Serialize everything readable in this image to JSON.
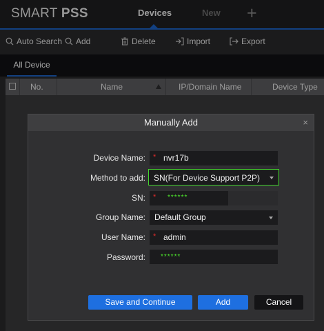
{
  "app": {
    "logo_prefix": "SMART ",
    "logo_bold": "PSS",
    "tabs": [
      {
        "label": "Devices",
        "active": true
      },
      {
        "label": "New",
        "active": false
      }
    ],
    "plus_label": "+"
  },
  "toolbar": {
    "auto_search": "Auto Search",
    "add": "Add",
    "delete": "Delete",
    "import": "Import",
    "export": "Export"
  },
  "list": {
    "tab": "All Device",
    "columns": [
      "No.",
      "Name",
      "IP/Domain Name",
      "Device Type"
    ]
  },
  "dialog": {
    "title": "Manually Add",
    "close_icon": "×",
    "fields": {
      "device_name": {
        "label": "Device Name:",
        "value": "nvr17b",
        "required": true
      },
      "method": {
        "label": "Method to add:",
        "value": "SN(For Device Support P2P)"
      },
      "sn": {
        "label": "SN:",
        "value": "******",
        "required": true
      },
      "group": {
        "label": "Group Name:",
        "value": "Default Group"
      },
      "user": {
        "label": "User Name:",
        "value": "admin",
        "required": true
      },
      "password": {
        "label": "Password:",
        "value": "******"
      }
    },
    "required_mark": "*",
    "buttons": {
      "save_continue": "Save and Continue",
      "add": "Add",
      "cancel": "Cancel"
    }
  },
  "colors": {
    "accent": "#1c63c7",
    "button_blue": "#1e6fe0",
    "highlight_green": "#44d62e",
    "required_red": "#e02b2b"
  }
}
